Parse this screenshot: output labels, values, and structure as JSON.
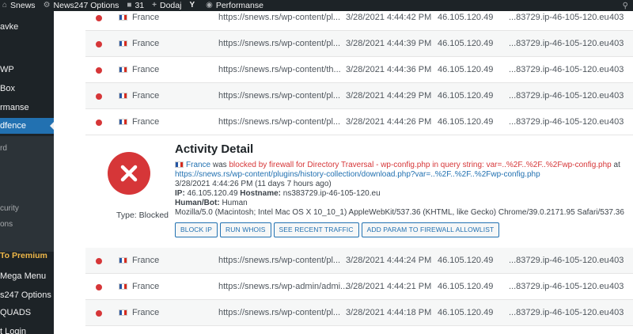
{
  "adminbar": {
    "items": [
      {
        "label": "Snews",
        "icon": "home-icon"
      },
      {
        "label": "News247 Options",
        "icon": "gear-icon"
      },
      {
        "label": "31",
        "icon": "comment-icon"
      },
      {
        "label": "Dodaj",
        "icon": "plus-icon"
      },
      {
        "label": "",
        "icon": "yoast-icon"
      },
      {
        "label": "Performanse",
        "icon": "gauge-icon"
      }
    ]
  },
  "sidebar": {
    "items": [
      {
        "label": "avke"
      },
      {
        "label": "WP"
      },
      {
        "label": "Box"
      },
      {
        "label": "rmanse"
      },
      {
        "label": "dfence",
        "active": true
      },
      {
        "label": "rd"
      },
      {
        "label": "curity"
      },
      {
        "label": "ons"
      },
      {
        "label": "To Premium"
      },
      {
        "label": "Mega Menu"
      },
      {
        "label": "s247 Options"
      },
      {
        "label": "QUADS"
      },
      {
        "label": "t Login"
      }
    ]
  },
  "table": {
    "rows_top": [
      {
        "country": "France",
        "url": "https://snews.rs/wp-content/pl...",
        "time": "3/28/2021 4:44:42 PM",
        "ip": "46.105.120.49",
        "hostname": "...83729.ip-46-105-120.eu",
        "code": "403"
      },
      {
        "country": "France",
        "url": "https://snews.rs/wp-content/pl...",
        "time": "3/28/2021 4:44:39 PM",
        "ip": "46.105.120.49",
        "hostname": "...83729.ip-46-105-120.eu",
        "code": "403"
      },
      {
        "country": "France",
        "url": "https://snews.rs/wp-content/th...",
        "time": "3/28/2021 4:44:36 PM",
        "ip": "46.105.120.49",
        "hostname": "...83729.ip-46-105-120.eu",
        "code": "403"
      },
      {
        "country": "France",
        "url": "https://snews.rs/wp-content/pl...",
        "time": "3/28/2021 4:44:29 PM",
        "ip": "46.105.120.49",
        "hostname": "...83729.ip-46-105-120.eu",
        "code": "403"
      },
      {
        "country": "France",
        "url": "https://snews.rs/wp-content/pl...",
        "time": "3/28/2021 4:44:26 PM",
        "ip": "46.105.120.49",
        "hostname": "...83729.ip-46-105-120.eu",
        "code": "403"
      }
    ],
    "rows_bottom": [
      {
        "country": "France",
        "url": "https://snews.rs/wp-content/pl...",
        "time": "3/28/2021 4:44:24 PM",
        "ip": "46.105.120.49",
        "hostname": "...83729.ip-46-105-120.eu",
        "code": "403"
      },
      {
        "country": "France",
        "url": "https://snews.rs/wp-admin/admi...",
        "time": "3/28/2021 4:44:21 PM",
        "ip": "46.105.120.49",
        "hostname": "...83729.ip-46-105-120.eu",
        "code": "403"
      },
      {
        "country": "France",
        "url": "https://snews.rs/wp-content/pl...",
        "time": "3/28/2021 4:44:18 PM",
        "ip": "46.105.120.49",
        "hostname": "...83729.ip-46-105-120.eu",
        "code": "403"
      }
    ]
  },
  "detail": {
    "title": "Activity Detail",
    "type_label": "Type: Blocked",
    "country": "France",
    "was": " was ",
    "blocked_text": "blocked by firewall for Directory Traversal - wp-config.php in query string: var=..%2F..%2F..%2Fwp-config.php",
    "at": " at",
    "url": "https://snews.rs/wp-content/plugins/history-collection/download.php?var=..%2F..%2F..%2Fwp-config.php",
    "timestamp": "3/28/2021 4:44:26 PM (11 days 7 hours ago)",
    "ip_label": "IP:",
    "ip_value": " 46.105.120.49 ",
    "hostname_label": "Hostname:",
    "hostname_value": " ns383729.ip-46-105-120.eu",
    "humanbot_label": "Human/Bot:",
    "humanbot_value": " Human",
    "user_agent": "Mozilla/5.0 (Macintosh; Intel Mac OS X 10_10_1) AppleWebKit/537.36 (KHTML, like Gecko) Chrome/39.0.2171.95 Safari/537.36",
    "buttons": {
      "block_ip": "BLOCK IP",
      "run_whois": "RUN WHOIS",
      "see_recent": "SEE RECENT TRAFFIC",
      "add_param": "ADD PARAM TO FIREWALL ALLOWLIST"
    }
  },
  "colors": {
    "accent": "#2271b1",
    "danger": "#d63638",
    "adminbar": "#1d2327"
  }
}
